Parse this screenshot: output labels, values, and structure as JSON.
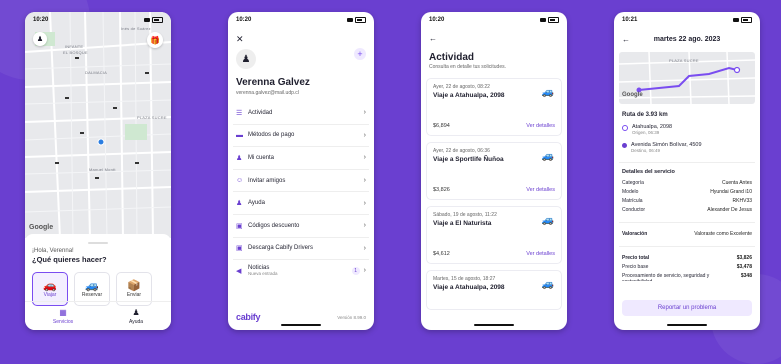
{
  "phone1": {
    "time": "10:20",
    "map_labels": [
      "INFANTE",
      "EL BOSQUE",
      "DALMACIA",
      "PLAZA SUCRE",
      "Manuel Montt",
      "Inés de Suárez"
    ],
    "google": "Google",
    "greeting": "¡Hola, Verenna!",
    "question": "¿Qué quieres hacer?",
    "services": [
      {
        "label": "Viajar",
        "icon": "🚗"
      },
      {
        "label": "Reservar",
        "icon": "🚙"
      },
      {
        "label": "Enviar",
        "icon": "📦"
      }
    ],
    "tabs": [
      {
        "label": "Servicios",
        "icon": "▦"
      },
      {
        "label": "Ayuda",
        "icon": "♟"
      }
    ]
  },
  "phone2": {
    "time": "10:20",
    "close": "✕",
    "plus": "+",
    "name": "Verenna Galvez",
    "email": "verenna.galvez@mail.udp.cl",
    "menu": [
      {
        "label": "Actividad",
        "icon": "☰"
      },
      {
        "label": "Métodos de pago",
        "icon": "▬"
      },
      {
        "label": "Mi cuenta",
        "icon": "♟"
      },
      {
        "label": "Invitar amigos",
        "icon": "☺"
      },
      {
        "label": "Ayuda",
        "icon": "♟"
      },
      {
        "label": "Códigos descuento",
        "icon": "▣"
      },
      {
        "label": "Descarga Cabify Drivers",
        "icon": "▣"
      },
      {
        "label": "Noticias",
        "sub": "Nueva entrada",
        "icon": "◀",
        "badge": "1"
      }
    ],
    "logo": "cabify",
    "version": "Versión 8.99.0"
  },
  "phone3": {
    "time": "10:20",
    "title": "Actividad",
    "subtitle": "Consulta en detalle tus solicitudes.",
    "link": "Ver detalles",
    "cards": [
      {
        "date": "Ayer, 22 de agosto, 08:22",
        "dest": "Viaje a Atahualpa, 2098",
        "price": "$6,894"
      },
      {
        "date": "Ayer, 22 de agosto, 06:36",
        "dest": "Viaje a Sportlife Ñuñoa",
        "price": "$3,826"
      },
      {
        "date": "Sábado, 19 de agosto, 11:22",
        "dest": "Viaje a El Naturista",
        "price": "$4,612"
      },
      {
        "date": "Martes, 15 de agosto, 18:27",
        "dest": "Viaje a Atahualpa, 2098",
        "price": ""
      }
    ]
  },
  "phone4": {
    "time": "10:21",
    "title": "martes 22 ago. 2023",
    "map_label": "PLAZA SUCRE",
    "google": "Google",
    "route": "Ruta de 3.93 km",
    "origin": {
      "name": "Atahualpa, 2098",
      "sub": "Origen, 06:39"
    },
    "dest": {
      "name": "Avenida Simón Bolívar, 4509",
      "sub": "Destino, 06:49"
    },
    "details_title": "Detalles del servicio",
    "details": [
      {
        "k": "Categoría",
        "v": "Cuenta Antes"
      },
      {
        "k": "Modelo",
        "v": "Hyundai Grand i10"
      },
      {
        "k": "Matrícula",
        "v": "RKHV33"
      },
      {
        "k": "Conductor",
        "v": "Alexander De Jesus"
      }
    ],
    "rating_k": "Valoración",
    "rating_v": "Valoraste como Excelente",
    "prices": [
      {
        "k": "Precio total",
        "v": "$3,826"
      },
      {
        "k": "Precio base",
        "v": "$3,478"
      },
      {
        "k": "Procesamiento de servicio, seguridad y sostenibilidad",
        "v": "$348"
      }
    ],
    "report": "Reportar un problema"
  },
  "colors": {
    "accent": "#6a3fd0",
    "bg": "#6a3fd0"
  }
}
